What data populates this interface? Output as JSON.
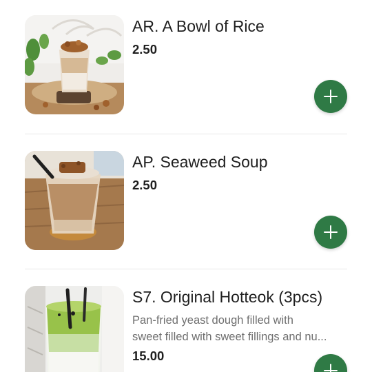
{
  "menu": {
    "items": [
      {
        "name": "AR. A Bowl of Rice",
        "price": "2.50",
        "image_icon": "iced-coffee-with-cookie-photo"
      },
      {
        "name": "AP. Seaweed Soup",
        "price": "2.50",
        "image_icon": "iced-latte-with-cookie-photo"
      },
      {
        "name": "S7. Original Hotteok (3pcs)",
        "description_line1": "Pan-fried yeast dough filled with",
        "description_line2": "sweet filled with sweet fillings and nu...",
        "price": "15.00",
        "image_icon": "matcha-latte-photo"
      }
    ],
    "add_icon": "plus-icon"
  },
  "colors": {
    "accent": "#2f7a45",
    "divider": "#e6e6e6",
    "price": "#1f1f1f",
    "description": "#6e6e6e"
  }
}
